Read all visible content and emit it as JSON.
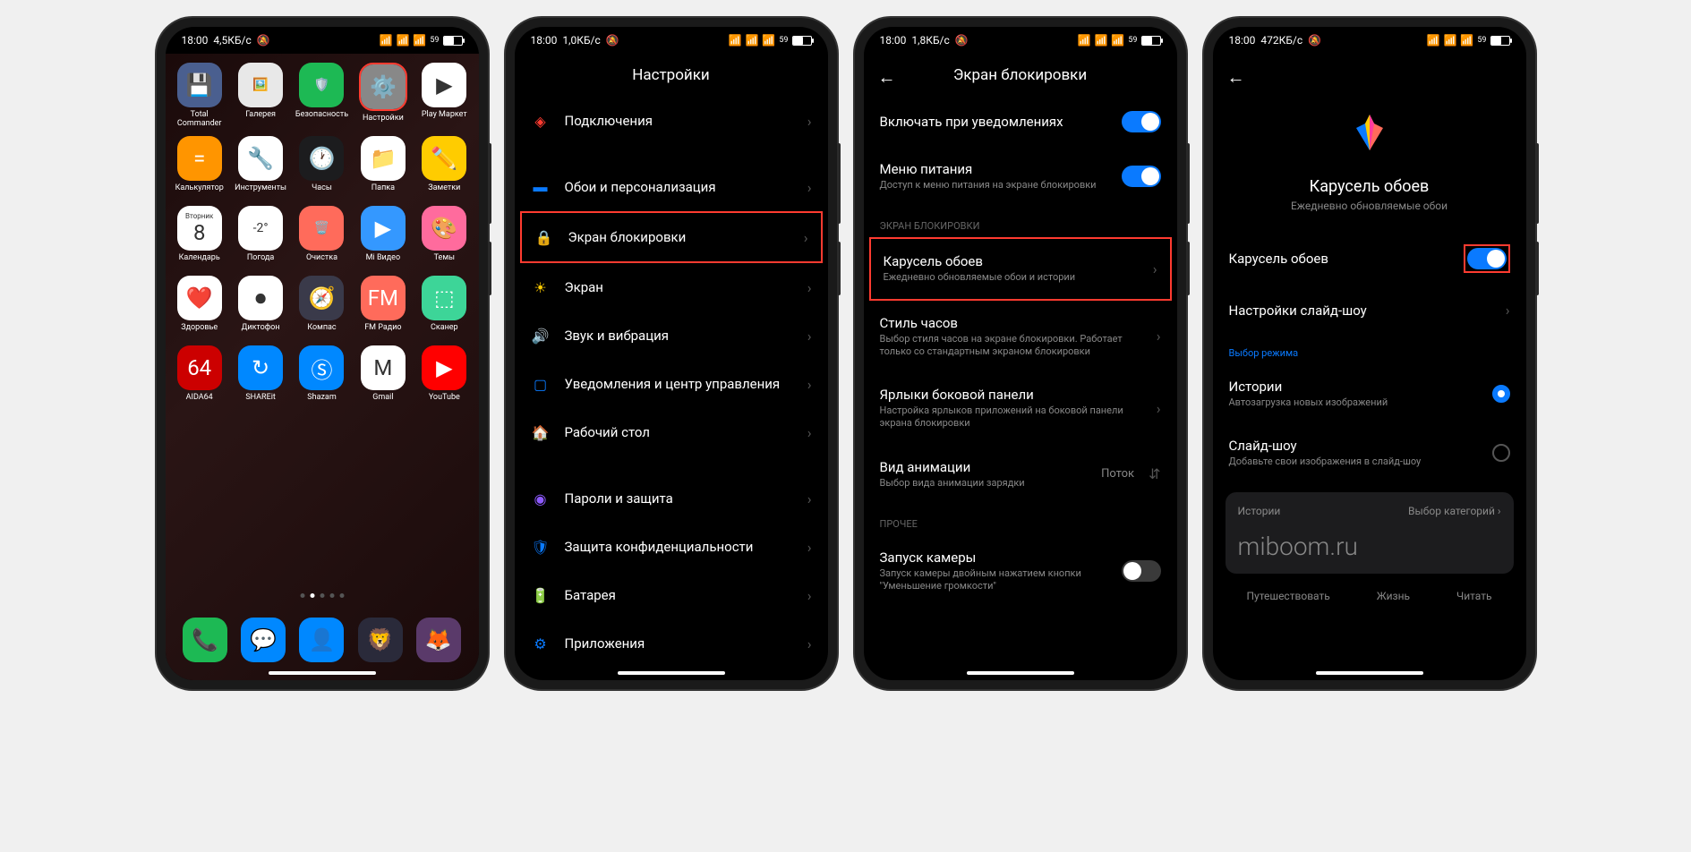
{
  "status": {
    "time": "18:00",
    "speed1": "4,5КБ/с",
    "speed2": "1,0КБ/с",
    "speed3": "1,8КБ/с",
    "speed4": "472КБ/с",
    "battery": "59"
  },
  "phone1": {
    "apps": [
      {
        "label": "Total Commander",
        "bg": "#4a5f8f",
        "emoji": "💾"
      },
      {
        "label": "Галерея",
        "bg": "#e8e8e8",
        "emoji": "🖼️"
      },
      {
        "label": "Безопасность",
        "bg": "#1db954",
        "emoji": "🛡️"
      },
      {
        "label": "Настройки",
        "bg": "#888",
        "emoji": "⚙️",
        "highlight": true
      },
      {
        "label": "Play Маркет",
        "bg": "#fff",
        "emoji": "▶"
      },
      {
        "label": "Калькулятор",
        "bg": "#ff9500",
        "emoji": "="
      },
      {
        "label": "Инструменты",
        "bg": "#fff",
        "emoji": "🔧"
      },
      {
        "label": "Часы",
        "bg": "#1c1c1e",
        "emoji": "🕐"
      },
      {
        "label": "Папка",
        "bg": "#fff",
        "emoji": "📁"
      },
      {
        "label": "Заметки",
        "bg": "#ffcc00",
        "emoji": "✏️"
      },
      {
        "label": "Календарь",
        "bg": "#fff",
        "emoji": "8",
        "extra": "Вторник"
      },
      {
        "label": "Погода",
        "bg": "#fff",
        "emoji": "-2°"
      },
      {
        "label": "Очистка",
        "bg": "#ff6b5b",
        "emoji": "🗑️"
      },
      {
        "label": "Mi Видео",
        "bg": "#3498ff",
        "emoji": "▶"
      },
      {
        "label": "Темы",
        "bg": "#ff6b9d",
        "emoji": "🎨"
      },
      {
        "label": "Здоровье",
        "bg": "#fff",
        "emoji": "❤️"
      },
      {
        "label": "Диктофон",
        "bg": "#fff",
        "emoji": "⏺"
      },
      {
        "label": "Компас",
        "bg": "#3a3a4a",
        "emoji": "🧭"
      },
      {
        "label": "FM Радио",
        "bg": "#ff6b5b",
        "emoji": "FM"
      },
      {
        "label": "Сканер",
        "bg": "#3dd598",
        "emoji": "⬚"
      },
      {
        "label": "AIDA64",
        "bg": "#cc0000",
        "emoji": "64"
      },
      {
        "label": "SHAREit",
        "bg": "#0088ff",
        "emoji": "↻"
      },
      {
        "label": "Shazam",
        "bg": "#0088ff",
        "emoji": "Ⓢ"
      },
      {
        "label": "Gmail",
        "bg": "#fff",
        "emoji": "M"
      },
      {
        "label": "YouTube",
        "bg": "#ff0000",
        "emoji": "▶"
      }
    ],
    "dock": [
      {
        "bg": "#1db954",
        "emoji": "📞"
      },
      {
        "bg": "#0088ff",
        "emoji": "💬"
      },
      {
        "bg": "#0088ff",
        "emoji": "👤"
      },
      {
        "bg": "#2a2a3a",
        "emoji": "🦁"
      },
      {
        "bg": "#5a3a6a",
        "emoji": "🦊"
      }
    ]
  },
  "phone2": {
    "title": "Настройки",
    "items": [
      {
        "icon": "◈",
        "color": "#ff3b30",
        "label": "Подключения"
      },
      {
        "icon": "▬",
        "color": "#0a7aff",
        "label": "Обои и персонализация"
      },
      {
        "icon": "🔒",
        "color": "#ff3b30",
        "label": "Экран блокировки",
        "highlight": true
      },
      {
        "icon": "☀",
        "color": "#ffcc00",
        "label": "Экран"
      },
      {
        "icon": "🔊",
        "color": "#1db954",
        "label": "Звук и вибрация"
      },
      {
        "icon": "▢",
        "color": "#0a7aff",
        "label": "Уведомления и центр управления"
      },
      {
        "icon": "🏠",
        "color": "#8e5aff",
        "label": "Рабочий стол"
      },
      {
        "icon": "◉",
        "color": "#8e5aff",
        "label": "Пароли и защита"
      },
      {
        "icon": "🛡",
        "color": "#0a7aff",
        "label": "Защита конфиденциальности"
      },
      {
        "icon": "🔋",
        "color": "#1db954",
        "label": "Батарея"
      },
      {
        "icon": "⚙",
        "color": "#0a7aff",
        "label": "Приложения"
      }
    ]
  },
  "phone3": {
    "title": "Экран блокировки",
    "top_item": {
      "label": "Включать при уведомлениях"
    },
    "menu_item": {
      "label": "Меню питания",
      "sub": "Доступ к меню питания на экране блокировки"
    },
    "section1": "ЭКРАН БЛОКИРОВКИ",
    "carousel": {
      "label": "Карусель обоев",
      "sub": "Ежедневно обновляемые обои и истории",
      "highlight": true
    },
    "clock": {
      "label": "Стиль часов",
      "sub": "Выбор стиля часов на экране блокировки. Работает только со стандартным экраном блокировки"
    },
    "shortcuts": {
      "label": "Ярлыки боковой панели",
      "sub": "Настройка ярлыков приложений на боковой панели экрана блокировки"
    },
    "animation": {
      "label": "Вид анимации",
      "sub": "Выбор вида анимации зарядки",
      "value": "Поток"
    },
    "section2": "ПРОЧЕЕ",
    "camera": {
      "label": "Запуск камеры",
      "sub": "Запуск камеры двойным нажатием кнопки \"Уменьшение громкости\""
    }
  },
  "phone4": {
    "feature_title": "Карусель обоев",
    "feature_sub": "Ежедневно обновляемые обои",
    "toggle_label": "Карусель обоев",
    "slideshow_settings": "Настройки слайд-шоу",
    "mode_section": "Выбор режима",
    "stories": {
      "label": "Истории",
      "sub": "Автозагрузка новых изображений"
    },
    "slideshow": {
      "label": "Слайд-шоу",
      "sub": "Добавьте свои изображения в слайд-шоу"
    },
    "card_title": "Истории",
    "card_action": "Выбор категорий",
    "domain": "miboom.ru",
    "tags": [
      "Путешествовать",
      "Жизнь",
      "Читать"
    ]
  }
}
